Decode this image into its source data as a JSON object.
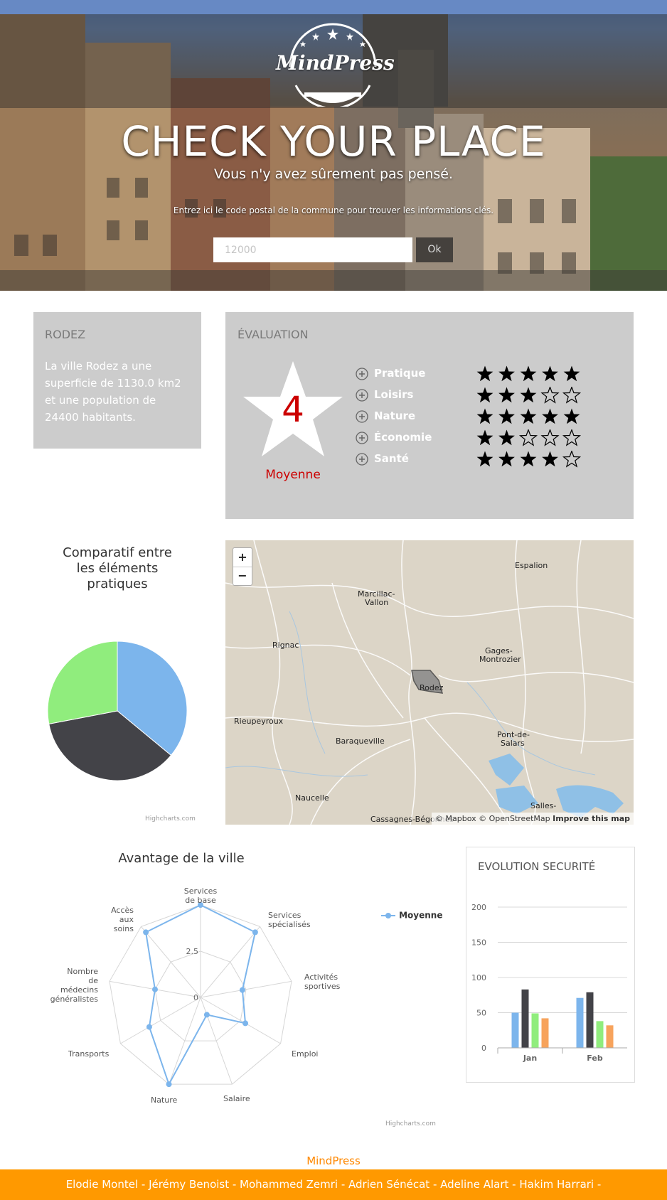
{
  "hero": {
    "logo_text": "MindPress",
    "title": "CHECK YOUR PLACE",
    "subtitle": "Vous n'y avez sûrement pas pensé.",
    "hint": "Entrez ici le code postal de la commune pour trouver les informations clés.",
    "search_placeholder": "12000",
    "ok_label": "Ok"
  },
  "city": {
    "name": "RODEZ",
    "description": "La ville Rodez a une superficie de 1130.0 km2 et une population de 24400 habitants."
  },
  "evaluation": {
    "title": "ÉVALUATION",
    "average_value": "4",
    "average_label": "Moyenne",
    "criteria": [
      {
        "label": "Pratique",
        "stars": 5
      },
      {
        "label": "Loisirs",
        "stars": 3
      },
      {
        "label": "Nature",
        "stars": 5
      },
      {
        "label": "Économie",
        "stars": 2
      },
      {
        "label": "Santé",
        "stars": 4
      }
    ],
    "max_stars": 5
  },
  "pie": {
    "title_lines": [
      "Comparatif entre",
      "les éléments",
      "pratiques"
    ],
    "credits": "Highcharts.com"
  },
  "map": {
    "zoom_in": "+",
    "zoom_out": "−",
    "attribution_prefix": "© Mapbox © OpenStreetMap ",
    "attribution_link": "Improve this map",
    "places": [
      "Espalion",
      "Marcillac-",
      "Vallon",
      "Rignac",
      "Gages-",
      "Montrozier",
      "Rodez",
      "Rieupeyroux",
      "Baraqueville",
      "Pont-de-",
      "Salars",
      "Naucelle",
      "Salles-",
      "Cassagnes-Bégonhès"
    ]
  },
  "radar": {
    "title": "Avantage de la ville",
    "axes": [
      "Services de base",
      "Services spécialisés",
      "Activités sportives",
      "Emploi",
      "Salaire",
      "Nature",
      "Transports",
      "Nombre de médecins généralistes",
      "Accès aux soins"
    ],
    "tick_labels": [
      "0",
      "2.5"
    ],
    "legend": "Moyenne",
    "credits": "Highcharts.com"
  },
  "bar": {
    "title": "EVOLUTION SECURITÉ",
    "y_ticks": [
      "0",
      "50",
      "100",
      "150",
      "200"
    ],
    "categories": [
      "Jan",
      "Feb"
    ]
  },
  "footer": {
    "brand": "MindPress",
    "names": "Elodie Montel - Jérémy Benoist - Mohammed Zemri - Adrien Sénécat - Adeline Alart - Hakim Harrari -"
  },
  "colors": {
    "accent_orange": "#ff9900",
    "card_grey": "#cccccc",
    "rating_red": "#cc0000",
    "series_blue": "#7cb5ec",
    "series_dark": "#434348",
    "series_green": "#90ed7d",
    "series_orange": "#f7a35c"
  },
  "chart_data": [
    {
      "type": "pie",
      "title": "Comparatif entre les éléments pratiques",
      "series": [
        {
          "values": [
            36,
            36,
            28
          ],
          "colors": [
            "#7cb5ec",
            "#434348",
            "#90ed7d"
          ]
        }
      ]
    },
    {
      "type": "radar",
      "title": "Avantage de la ville",
      "categories": [
        "Services de base",
        "Services spécialisés",
        "Activités sportives",
        "Emploi",
        "Salaire",
        "Nature",
        "Transports",
        "Nombre de médecins généralistes",
        "Accès aux soins"
      ],
      "series": [
        {
          "name": "Moyenne",
          "values": [
            5,
            4.6,
            2.3,
            2.8,
            1,
            5,
            3.2,
            2.5,
            4.6
          ]
        }
      ],
      "ylim": [
        0,
        5
      ]
    },
    {
      "type": "bar",
      "title": "EVOLUTION SECURITÉ",
      "categories": [
        "Jan",
        "Feb"
      ],
      "series": [
        {
          "values": [
            50,
            71
          ],
          "color": "#7cb5ec"
        },
        {
          "values": [
            83,
            79
          ],
          "color": "#434348"
        },
        {
          "values": [
            49,
            38
          ],
          "color": "#90ed7d"
        },
        {
          "values": [
            42,
            32
          ],
          "color": "#f7a35c"
        }
      ],
      "ylim": [
        0,
        200
      ]
    }
  ]
}
